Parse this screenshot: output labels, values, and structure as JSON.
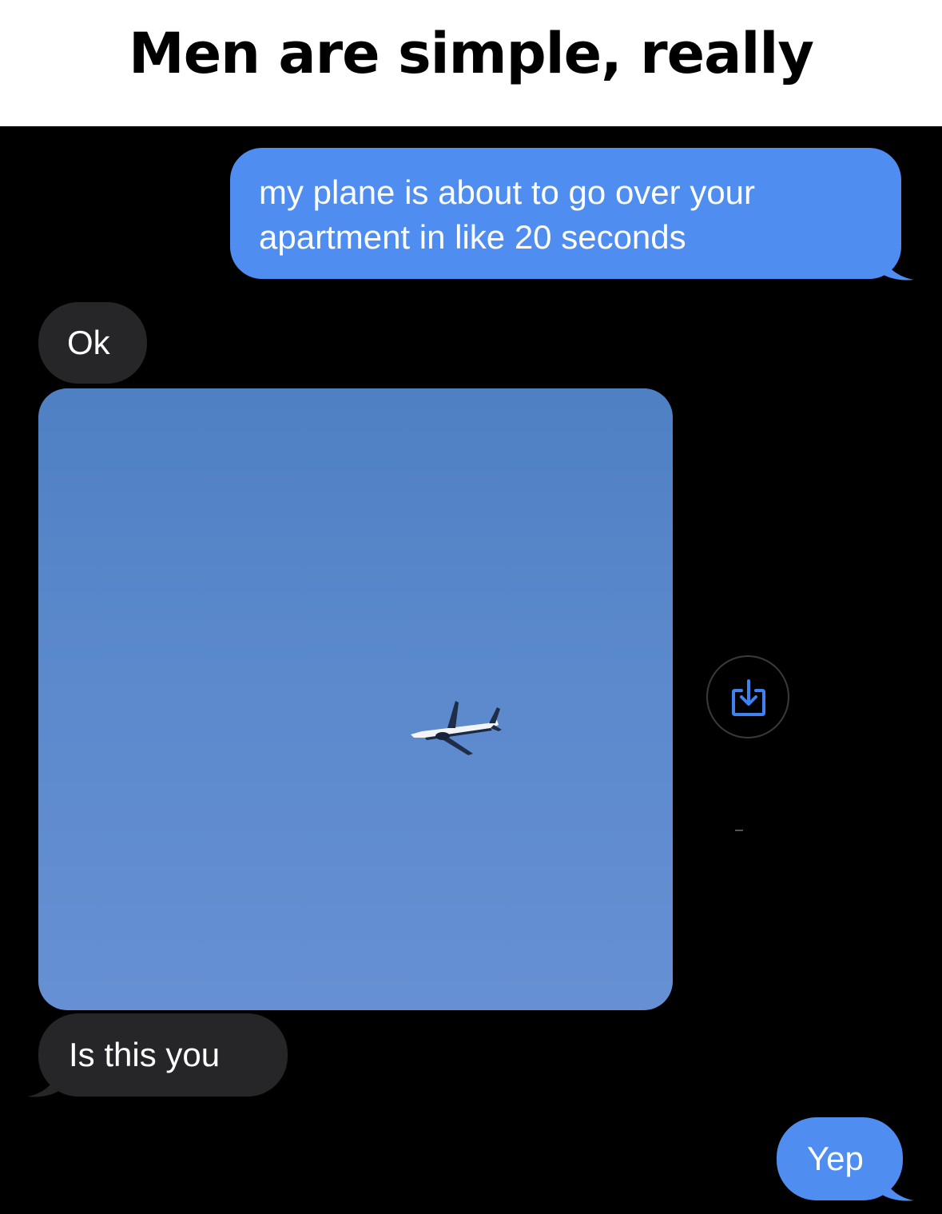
{
  "caption": {
    "title": "Men are simple, really"
  },
  "conversation": {
    "messages": [
      {
        "from": "me",
        "text": "my plane is about to go over your apartment in like 20 seconds"
      },
      {
        "from": "them",
        "text": "Ok"
      },
      {
        "from": "them",
        "attachment": "photo of airplane in blue sky"
      },
      {
        "from": "them",
        "text": "Is this you"
      },
      {
        "from": "me",
        "text": "Yep"
      }
    ]
  },
  "icons": {
    "save_attachment": "download-icon"
  },
  "colors": {
    "sent_bubble": "#4f8ef0",
    "received_bubble": "#262628",
    "background": "#000000",
    "sky": "#5b89cc"
  }
}
